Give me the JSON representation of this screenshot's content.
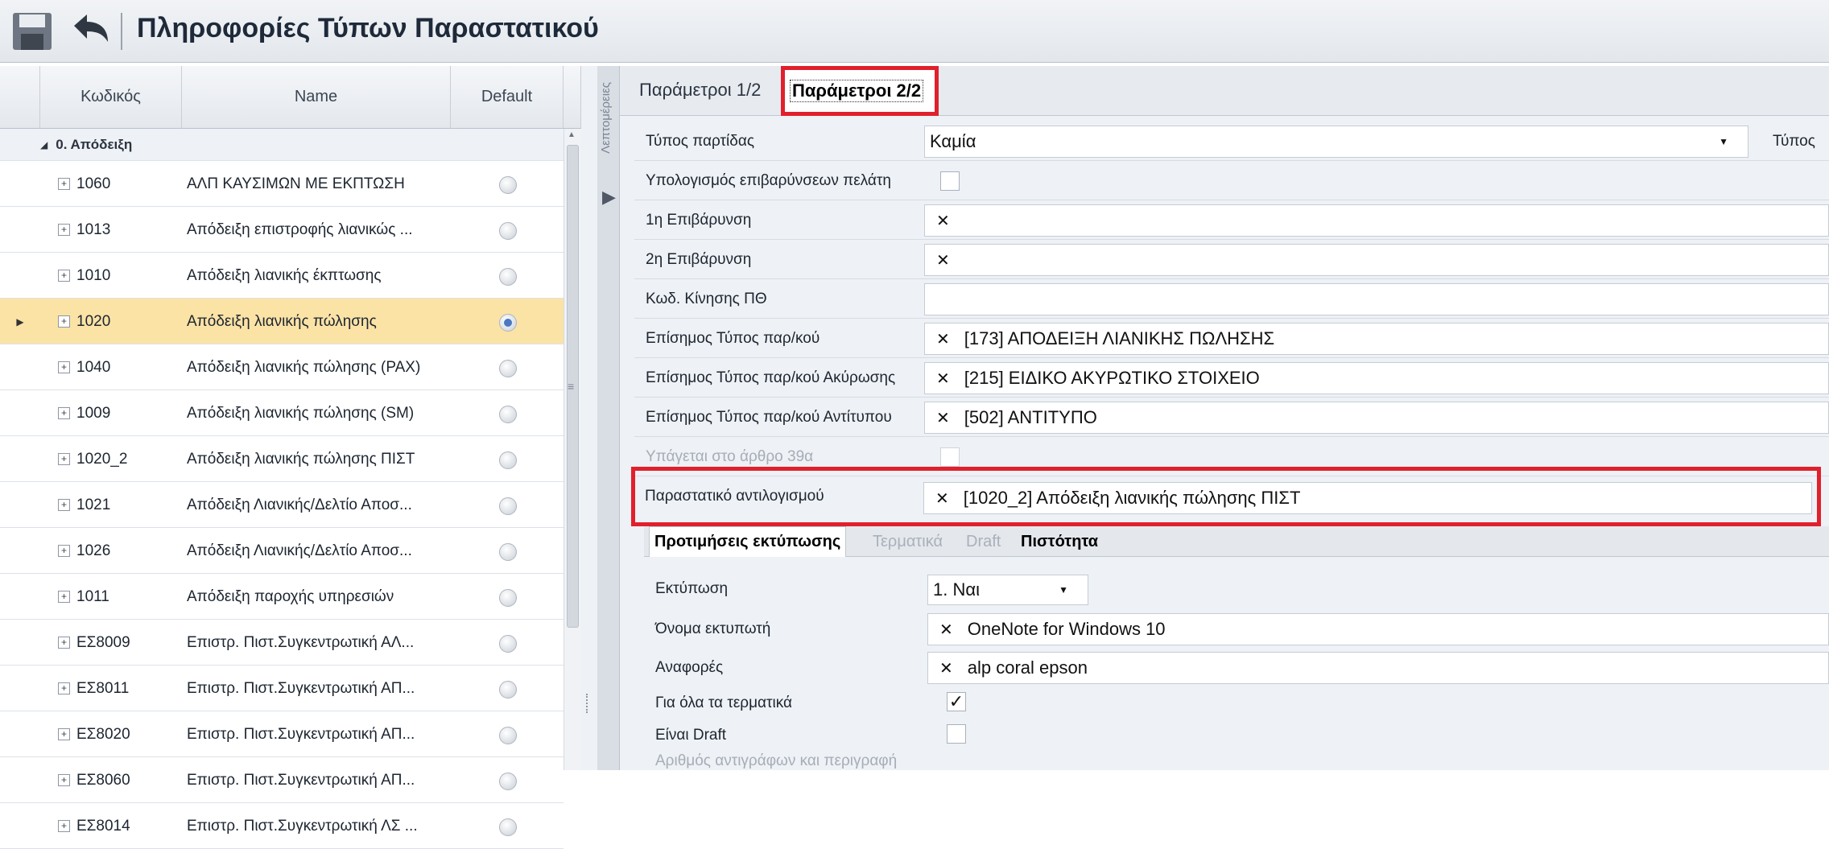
{
  "window": {
    "title": "Πληροφορίες Τύπων Παραστατικού"
  },
  "icons": {
    "save": "save-icon",
    "undo": "undo-icon"
  },
  "grid": {
    "columns": [
      "Κωδικός",
      "Name",
      "Default"
    ],
    "group": "0. Απόδειξη",
    "rows": [
      {
        "code": "1060",
        "name": "ΑΛΠ ΚΑΥΣΙΜΩΝ ΜΕ ΕΚΠΤΩΣΗ",
        "sel": false,
        "exp": "⊞"
      },
      {
        "code": "1013",
        "name": "Απόδειξη επιστροφής λιανικώς ...",
        "sel": false,
        "exp": "⊞"
      },
      {
        "code": "1010",
        "name": "Απόδειξη λιανικής έκπτωσης",
        "sel": false,
        "exp": "⊞"
      },
      {
        "code": "1020",
        "name": "Απόδειξη λιανικής πώλησης",
        "sel": true,
        "exp": "⊞"
      },
      {
        "code": "1040",
        "name": "Απόδειξη λιανικής πώλησης (PAX)",
        "sel": false,
        "exp": "⊞"
      },
      {
        "code": "1009",
        "name": "Απόδειξη λιανικής πώλησης (SM)",
        "sel": false,
        "exp": "⊞"
      },
      {
        "code": "1020_2",
        "name": "Απόδειξη λιανικής πώλησης ΠΙΣΤ",
        "sel": false,
        "exp": "⊞"
      },
      {
        "code": "1021",
        "name": "Απόδειξη Λιανικής/Δελτίο Αποσ...",
        "sel": false,
        "exp": "⊞"
      },
      {
        "code": "1026",
        "name": "Απόδειξη Λιανικής/Δελτίο Αποσ...",
        "sel": false,
        "exp": "⊞"
      },
      {
        "code": "1011",
        "name": "Απόδειξη παροχής υπηρεσιών",
        "sel": false,
        "exp": "⊞"
      },
      {
        "code": "ΕΣ8009",
        "name": "Επιστρ. Πιστ.Συγκεντρωτική ΑΛ...",
        "sel": false,
        "exp": "⊞"
      },
      {
        "code": "ΕΣ8011",
        "name": "Επιστρ. Πιστ.Συγκεντρωτική ΑΠ...",
        "sel": false,
        "exp": "⊞"
      },
      {
        "code": "ΕΣ8020",
        "name": "Επιστρ. Πιστ.Συγκεντρωτική ΑΠ...",
        "sel": false,
        "exp": "⊞"
      },
      {
        "code": "ΕΣ8060",
        "name": "Επιστρ. Πιστ.Συγκεντρωτική ΑΠ...",
        "sel": false,
        "exp": "⊞"
      },
      {
        "code": "ΕΣ8014",
        "name": "Επιστρ. Πιστ.Συγκεντρωτική ΛΣ ...",
        "sel": false,
        "exp": "⊞"
      }
    ]
  },
  "side_strip": {
    "label": "Λεπτομέρειες"
  },
  "tabs": {
    "params1": "Παράμετροι 1/2",
    "params2": "Παράμετροι 2/2"
  },
  "params": {
    "batch_type": {
      "label": "Τύπος παρτίδας",
      "value": "Καμία",
      "extra_label": "Τύπος"
    },
    "calc_charges": {
      "label": "Υπολογισμός επιβαρύνσεων πελάτη"
    },
    "charge1": {
      "label": "1η Επιβάρυνση"
    },
    "charge2": {
      "label": "2η Επιβάρυνση"
    },
    "movement_code": {
      "label": "Κωδ. Κίνησης ΠΘ"
    },
    "official_type": {
      "label": "Επίσημος Τύπος παρ/κού",
      "value": "[173] ΑΠΟΔΕΙΞΗ ΛΙΑΝΙΚΗΣ ΠΩΛΗΣΗΣ"
    },
    "official_cancel": {
      "label": "Επίσημος Τύπος παρ/κού Ακύρωσης",
      "value": "[215] ΕΙΔΙΚΟ ΑΚΥΡΩΤΙΚΟ ΣΤΟΙΧΕΙΟ"
    },
    "official_copy": {
      "label": "Επίσημος Τύπος παρ/κού Αντίτυπου",
      "value": "[502] ΑΝΤΙΤΥΠΟ"
    },
    "article39": {
      "label": "Υπάγεται στο άρθρο 39α"
    },
    "reversal_doc": {
      "label": "Παραστατικό αντιλογισμού",
      "value": "[1020_2] Απόδειξη λιανικής πώλησης ΠΙΣΤ"
    }
  },
  "subtabs": {
    "print_prefs": "Προτιμήσεις εκτύπωσης",
    "terminals": "Τερματικά",
    "draft": "Draft",
    "credit": "Πιστότητα"
  },
  "print": {
    "printing": {
      "label": "Εκτύπωση",
      "value": "1. Ναι"
    },
    "printer": {
      "label": "Όνομα εκτυπωτή",
      "value": "OneNote for Windows 10"
    },
    "reports": {
      "label": "Αναφορές",
      "value": "alp coral epson"
    },
    "all_terminals": {
      "label": "Για όλα τα τερματικά"
    },
    "is_draft": {
      "label": "Είναι Draft"
    },
    "copies": {
      "label": "Αριθμός αντιγράφων και περιγραφή"
    }
  },
  "colors": {
    "highlight": "#e0202c",
    "selected_row": "#fbe3a6"
  }
}
